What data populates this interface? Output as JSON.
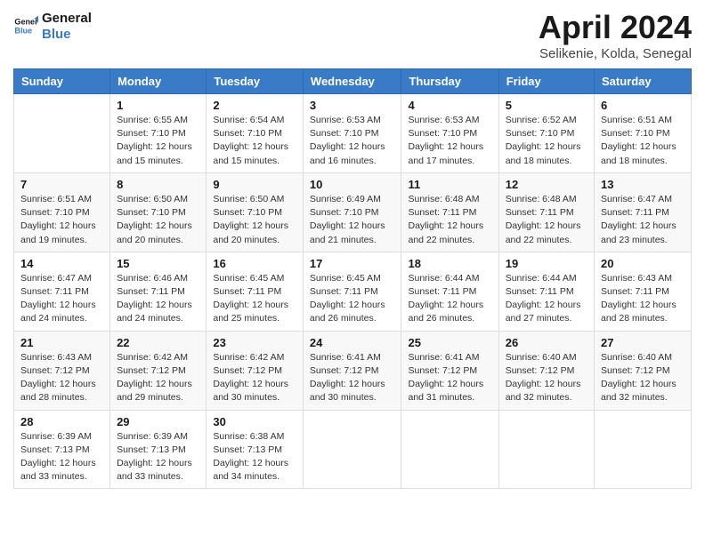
{
  "logo": {
    "line1": "General",
    "line2": "Blue"
  },
  "title": "April 2024",
  "location": "Selikenie, Kolda, Senegal",
  "days_of_week": [
    "Sunday",
    "Monday",
    "Tuesday",
    "Wednesday",
    "Thursday",
    "Friday",
    "Saturday"
  ],
  "weeks": [
    [
      {
        "day": "",
        "info": ""
      },
      {
        "day": "1",
        "info": "Sunrise: 6:55 AM\nSunset: 7:10 PM\nDaylight: 12 hours\nand 15 minutes."
      },
      {
        "day": "2",
        "info": "Sunrise: 6:54 AM\nSunset: 7:10 PM\nDaylight: 12 hours\nand 15 minutes."
      },
      {
        "day": "3",
        "info": "Sunrise: 6:53 AM\nSunset: 7:10 PM\nDaylight: 12 hours\nand 16 minutes."
      },
      {
        "day": "4",
        "info": "Sunrise: 6:53 AM\nSunset: 7:10 PM\nDaylight: 12 hours\nand 17 minutes."
      },
      {
        "day": "5",
        "info": "Sunrise: 6:52 AM\nSunset: 7:10 PM\nDaylight: 12 hours\nand 18 minutes."
      },
      {
        "day": "6",
        "info": "Sunrise: 6:51 AM\nSunset: 7:10 PM\nDaylight: 12 hours\nand 18 minutes."
      }
    ],
    [
      {
        "day": "7",
        "info": "Sunrise: 6:51 AM\nSunset: 7:10 PM\nDaylight: 12 hours\nand 19 minutes."
      },
      {
        "day": "8",
        "info": "Sunrise: 6:50 AM\nSunset: 7:10 PM\nDaylight: 12 hours\nand 20 minutes."
      },
      {
        "day": "9",
        "info": "Sunrise: 6:50 AM\nSunset: 7:10 PM\nDaylight: 12 hours\nand 20 minutes."
      },
      {
        "day": "10",
        "info": "Sunrise: 6:49 AM\nSunset: 7:10 PM\nDaylight: 12 hours\nand 21 minutes."
      },
      {
        "day": "11",
        "info": "Sunrise: 6:48 AM\nSunset: 7:11 PM\nDaylight: 12 hours\nand 22 minutes."
      },
      {
        "day": "12",
        "info": "Sunrise: 6:48 AM\nSunset: 7:11 PM\nDaylight: 12 hours\nand 22 minutes."
      },
      {
        "day": "13",
        "info": "Sunrise: 6:47 AM\nSunset: 7:11 PM\nDaylight: 12 hours\nand 23 minutes."
      }
    ],
    [
      {
        "day": "14",
        "info": "Sunrise: 6:47 AM\nSunset: 7:11 PM\nDaylight: 12 hours\nand 24 minutes."
      },
      {
        "day": "15",
        "info": "Sunrise: 6:46 AM\nSunset: 7:11 PM\nDaylight: 12 hours\nand 24 minutes."
      },
      {
        "day": "16",
        "info": "Sunrise: 6:45 AM\nSunset: 7:11 PM\nDaylight: 12 hours\nand 25 minutes."
      },
      {
        "day": "17",
        "info": "Sunrise: 6:45 AM\nSunset: 7:11 PM\nDaylight: 12 hours\nand 26 minutes."
      },
      {
        "day": "18",
        "info": "Sunrise: 6:44 AM\nSunset: 7:11 PM\nDaylight: 12 hours\nand 26 minutes."
      },
      {
        "day": "19",
        "info": "Sunrise: 6:44 AM\nSunset: 7:11 PM\nDaylight: 12 hours\nand 27 minutes."
      },
      {
        "day": "20",
        "info": "Sunrise: 6:43 AM\nSunset: 7:11 PM\nDaylight: 12 hours\nand 28 minutes."
      }
    ],
    [
      {
        "day": "21",
        "info": "Sunrise: 6:43 AM\nSunset: 7:12 PM\nDaylight: 12 hours\nand 28 minutes."
      },
      {
        "day": "22",
        "info": "Sunrise: 6:42 AM\nSunset: 7:12 PM\nDaylight: 12 hours\nand 29 minutes."
      },
      {
        "day": "23",
        "info": "Sunrise: 6:42 AM\nSunset: 7:12 PM\nDaylight: 12 hours\nand 30 minutes."
      },
      {
        "day": "24",
        "info": "Sunrise: 6:41 AM\nSunset: 7:12 PM\nDaylight: 12 hours\nand 30 minutes."
      },
      {
        "day": "25",
        "info": "Sunrise: 6:41 AM\nSunset: 7:12 PM\nDaylight: 12 hours\nand 31 minutes."
      },
      {
        "day": "26",
        "info": "Sunrise: 6:40 AM\nSunset: 7:12 PM\nDaylight: 12 hours\nand 32 minutes."
      },
      {
        "day": "27",
        "info": "Sunrise: 6:40 AM\nSunset: 7:12 PM\nDaylight: 12 hours\nand 32 minutes."
      }
    ],
    [
      {
        "day": "28",
        "info": "Sunrise: 6:39 AM\nSunset: 7:13 PM\nDaylight: 12 hours\nand 33 minutes."
      },
      {
        "day": "29",
        "info": "Sunrise: 6:39 AM\nSunset: 7:13 PM\nDaylight: 12 hours\nand 33 minutes."
      },
      {
        "day": "30",
        "info": "Sunrise: 6:38 AM\nSunset: 7:13 PM\nDaylight: 12 hours\nand 34 minutes."
      },
      {
        "day": "",
        "info": ""
      },
      {
        "day": "",
        "info": ""
      },
      {
        "day": "",
        "info": ""
      },
      {
        "day": "",
        "info": ""
      }
    ]
  ]
}
